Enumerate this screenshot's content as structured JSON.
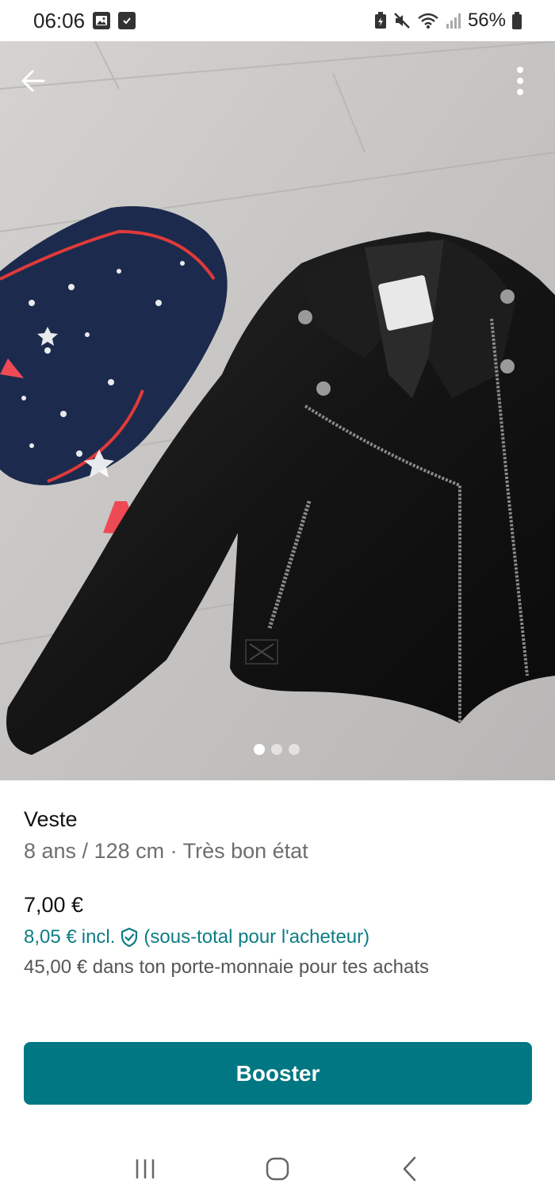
{
  "status_bar": {
    "time": "06:06",
    "battery": "56%",
    "icons": [
      "gallery-icon",
      "checkbox-icon",
      "battery-saver-icon",
      "mute-icon",
      "wifi-icon",
      "signal-icon",
      "battery-icon"
    ]
  },
  "photo": {
    "page_count": 3,
    "active_page": 1,
    "back_icon": "arrow-left-icon",
    "menu_icon": "more-vertical-icon"
  },
  "item": {
    "title": "Veste",
    "meta": "8 ans / 128 cm · Très bon état",
    "price": "7,00 €",
    "buyer_price": "8,05 €",
    "buyer_incl": "incl.",
    "buyer_note": "(sous-total pour l'acheteur)",
    "wallet": "45,00 € dans ton porte-monnaie pour tes achats"
  },
  "actions": {
    "booster_label": "Booster"
  },
  "colors": {
    "accent": "#007782",
    "accent_text": "#0d7d86"
  },
  "nav": {
    "icons": [
      "recent-apps-icon",
      "home-icon",
      "back-icon"
    ]
  }
}
